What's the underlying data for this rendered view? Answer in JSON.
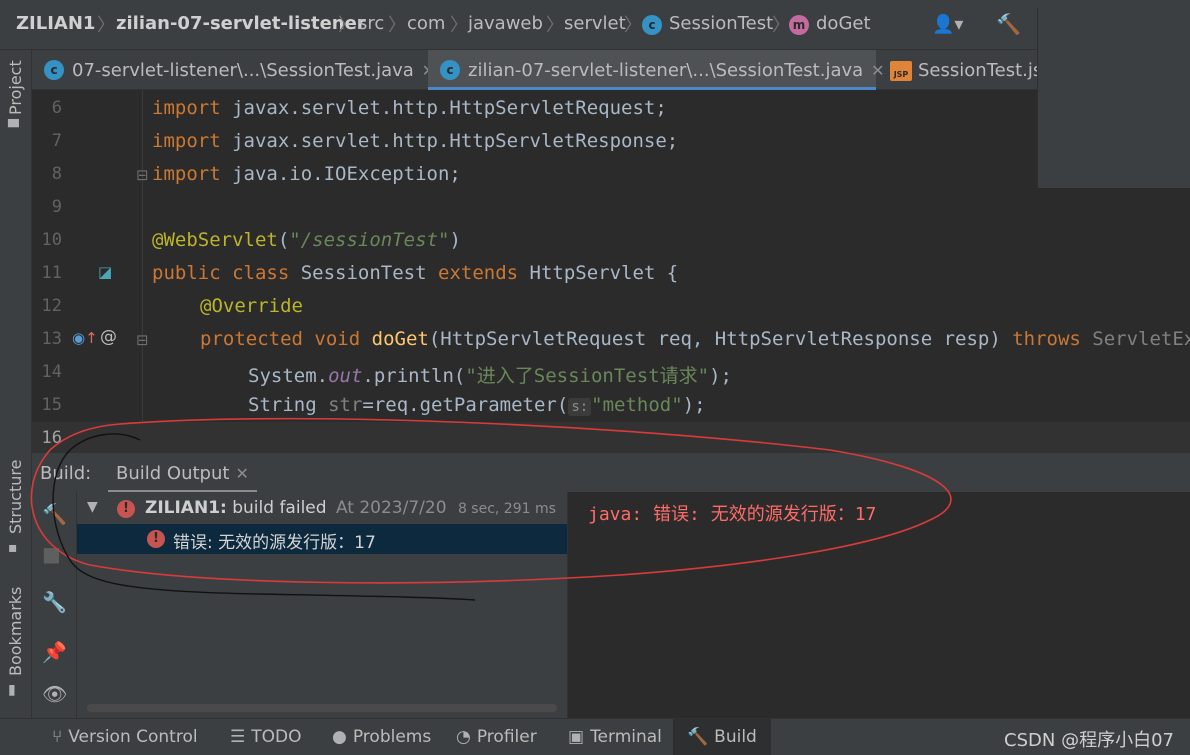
{
  "breadcrumb": {
    "items": [
      "ZILIAN1",
      "zilian-07-servlet-listener",
      "src",
      "com",
      "javaweb",
      "servlet",
      "SessionTest",
      "doGet"
    ],
    "class_icon_letter": "c",
    "method_icon_letter": "m"
  },
  "left_strip": {
    "project": "Project",
    "structure": "Structure",
    "bookmarks": "Bookmarks"
  },
  "tabs": [
    {
      "label": "07-servlet-listener\\...\\SessionTest.java",
      "icon": "c"
    },
    {
      "label": "zilian-07-servlet-listener\\...\\SessionTest.java",
      "icon": "c"
    },
    {
      "label": "SessionTest.jsp",
      "icon": "JSP"
    }
  ],
  "editor": {
    "line_numbers": [
      "6",
      "7",
      "8",
      "9",
      "10",
      "11",
      "12",
      "13",
      "14",
      "15",
      "16"
    ],
    "code": {
      "l6_kw": "import",
      "l6_rest": " javax.servlet.http.HttpServletRequest;",
      "l7_kw": "import",
      "l7_rest": " javax.servlet.http.HttpServletResponse;",
      "l8_kw": "import",
      "l8_rest": " java.io.IOException;",
      "l10_an": "@WebServlet",
      "l10_p1": "(",
      "l10_st": "\"/sessionTest\"",
      "l10_p2": ")",
      "l11_kw1": "public",
      "l11_kw2": "class",
      "l11_name": " SessionTest ",
      "l11_kw3": "extends",
      "l11_rest": " HttpServlet {",
      "l12_an": "@Override",
      "l13_kw1": "protected",
      "l13_kw2": "void",
      "l13_fn": "doGet",
      "l13_params": "(HttpServletRequest req, HttpServletResponse resp) ",
      "l13_kw3": "throws",
      "l13_tail": " ServletException",
      "l14_a": "System.",
      "l14_out": "out",
      "l14_b": ".println(",
      "l14_st": "\"进入了SessionTest请求\"",
      "l14_c": ");",
      "l15_a": "String ",
      "l15_var": "str",
      "l15_b": "=req.getParameter(",
      "l15_hint": "s:",
      "l15_st": "\"method\"",
      "l15_c": ");"
    }
  },
  "build": {
    "label": "Build:",
    "tab": "Build Output",
    "tree": {
      "project": "ZILIAN1:",
      "status": " build failed",
      "time": "At 2023/7/20",
      "duration": "8 sec, 291 ms",
      "error": "错误: 无效的源发行版：17"
    },
    "output": "java: 错误: 无效的源发行版：17"
  },
  "bottom_bar": {
    "items": [
      "Version Control",
      "TODO",
      "Problems",
      "Profiler",
      "Terminal",
      "Build"
    ],
    "watermark": "CSDN @程序小白07"
  },
  "colors": {
    "background": "#2b2b2b",
    "panel": "#3c3f41",
    "keyword": "#cc7832",
    "annotation": "#bbb529",
    "string": "#6a8759",
    "method": "#ffc66d",
    "error": "#c75450",
    "selection": "#0d293e"
  }
}
